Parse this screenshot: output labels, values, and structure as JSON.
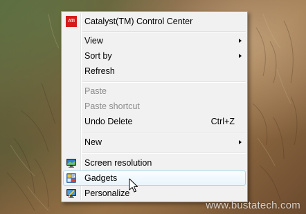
{
  "menu": {
    "items": [
      {
        "label": "Catalyst(TM) Control Center",
        "icon": "ati-icon",
        "icon_text": "ATI"
      },
      {
        "label": "View",
        "submenu": true
      },
      {
        "label": "Sort by",
        "submenu": true
      },
      {
        "label": "Refresh"
      },
      {
        "label": "Paste",
        "disabled": true
      },
      {
        "label": "Paste shortcut",
        "disabled": true
      },
      {
        "label": "Undo Delete",
        "accelerator": "Ctrl+Z"
      },
      {
        "label": "New",
        "submenu": true
      },
      {
        "label": "Screen resolution",
        "icon": "monitor-icon"
      },
      {
        "label": "Gadgets",
        "icon": "gadgets-icon",
        "highlighted": true
      },
      {
        "label": "Personalize",
        "icon": "personalize-icon"
      }
    ]
  },
  "watermark": "www.bustatech.com",
  "colors": {
    "menu_background": "#f1f1f1",
    "menu_border": "#979797",
    "disabled_text": "#8c8c8c",
    "hover_border": "#a8d8eb",
    "ati_red": "#d41a1a"
  }
}
